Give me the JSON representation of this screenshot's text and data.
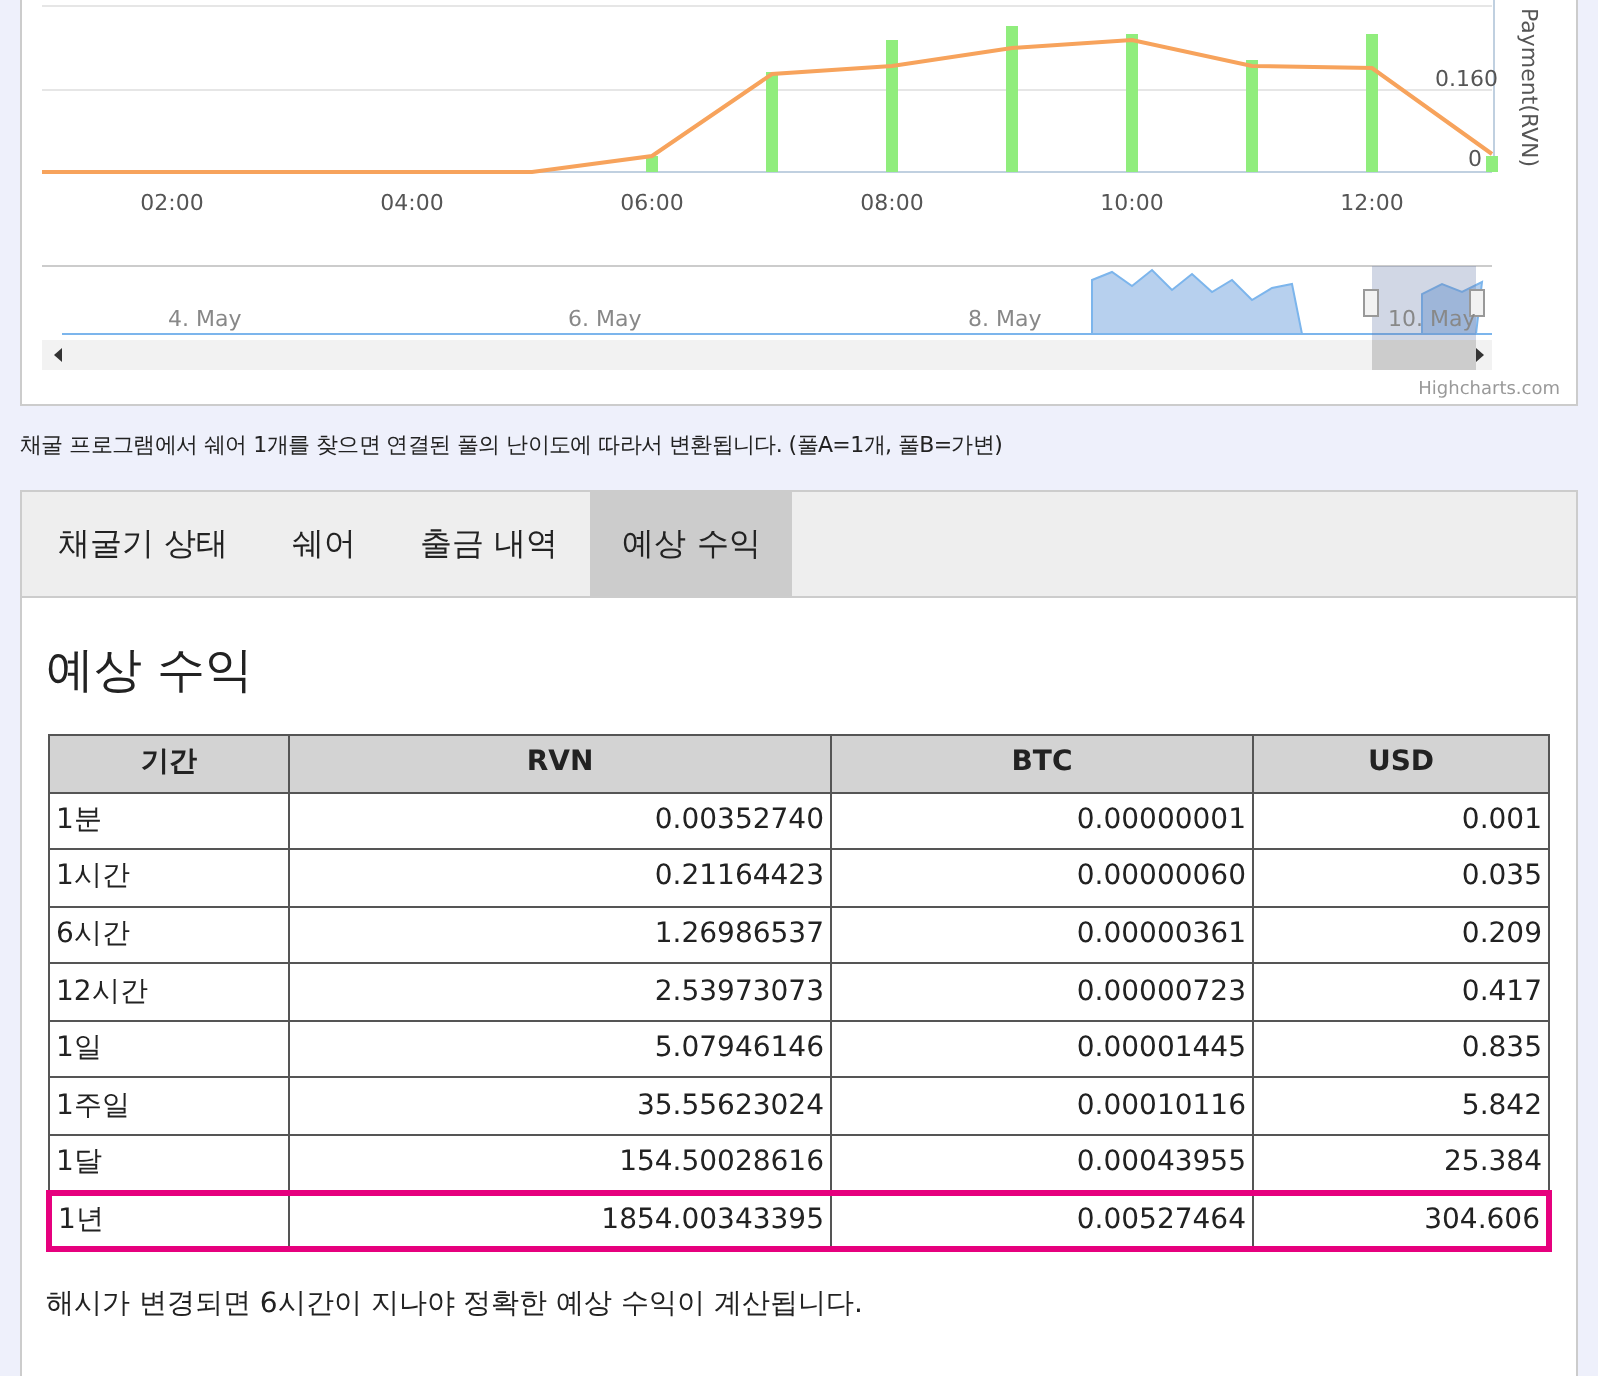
{
  "chart": {
    "x_tick_labels": [
      "02:00",
      "04:00",
      "06:00",
      "08:00",
      "10:00",
      "12:00"
    ],
    "y_axis_labels": [
      "0.160",
      "0"
    ],
    "y_axis_title": "Payment(RVN)",
    "navigator_labels": [
      "4. May",
      "6. May",
      "8. May",
      "10. May"
    ],
    "credit": "Highcharts.com"
  },
  "chart_note": "채굴 프로그램에서 쉐어 1개를 찾으면 연결된 풀의 난이도에 따라서 변환됩니다. (풀A=1개, 풀B=가변)",
  "tabs": [
    {
      "label": "채굴기 상태",
      "selected": false
    },
    {
      "label": "쉐어",
      "selected": false
    },
    {
      "label": "출금 내역",
      "selected": false
    },
    {
      "label": "예상 수익",
      "selected": true
    }
  ],
  "heading": "예상 수익",
  "table": {
    "columns": [
      "기간",
      "RVN",
      "BTC",
      "USD"
    ],
    "rows": [
      {
        "cells": [
          "1분",
          "0.00352740",
          "0.00000001",
          "0.001"
        ],
        "highlighted": false
      },
      {
        "cells": [
          "1시간",
          "0.21164423",
          "0.00000060",
          "0.035"
        ],
        "highlighted": false
      },
      {
        "cells": [
          "6시간",
          "1.26986537",
          "0.00000361",
          "0.209"
        ],
        "highlighted": false
      },
      {
        "cells": [
          "12시간",
          "2.53973073",
          "0.00000723",
          "0.417"
        ],
        "highlighted": false
      },
      {
        "cells": [
          "1일",
          "5.07946146",
          "0.00001445",
          "0.835"
        ],
        "highlighted": false
      },
      {
        "cells": [
          "1주일",
          "35.55623024",
          "0.00010116",
          "5.842"
        ],
        "highlighted": false
      },
      {
        "cells": [
          "1달",
          "154.50028616",
          "0.00043955",
          "25.384"
        ],
        "highlighted": false
      },
      {
        "cells": [
          "1년",
          "1854.00343395",
          "0.00527464",
          "304.606"
        ],
        "highlighted": true
      }
    ]
  },
  "footer_note": "해시가 변경되면 6시간이 지나야 정확한 예상 수익이 계산됩니다."
}
